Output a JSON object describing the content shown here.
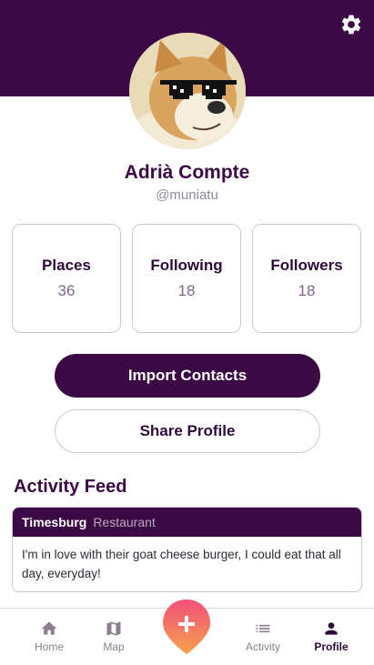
{
  "profile": {
    "name": "Adrià Compte",
    "handle": "@muniatu"
  },
  "stats": [
    {
      "label": "Places",
      "value": "36"
    },
    {
      "label": "Following",
      "value": "18"
    },
    {
      "label": "Followers",
      "value": "18"
    }
  ],
  "actions": {
    "import_label": "Import Contacts",
    "share_label": "Share Profile"
  },
  "feed": {
    "title": "Activity Feed",
    "items": [
      {
        "place": "Timesburg",
        "category": "Restaurant",
        "text": "I'm in love with their goat cheese burger, I could eat that all day, everyday!"
      }
    ]
  },
  "nav": {
    "items": [
      {
        "label": "Home",
        "icon": "home-icon"
      },
      {
        "label": "Map",
        "icon": "map-icon"
      },
      {
        "label": "Activity",
        "icon": "list-icon"
      },
      {
        "label": "Profile",
        "icon": "person-icon",
        "active": true
      }
    ],
    "fab_icon": "plus-icon"
  },
  "colors": {
    "brand": "#3b0a45",
    "fab_gradient_top": "#f0507a",
    "fab_gradient_bottom": "#f7a14a"
  }
}
